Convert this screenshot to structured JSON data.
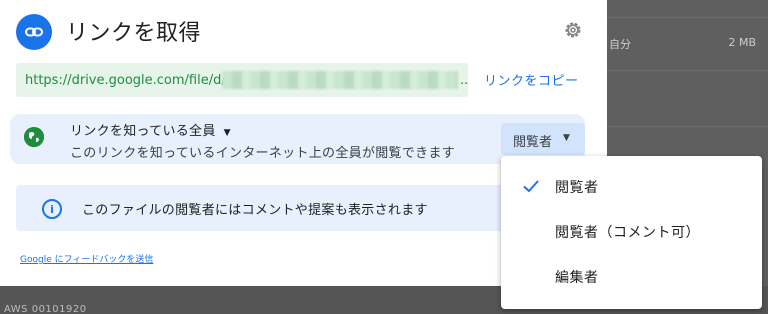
{
  "background": {
    "owner_text": "自分",
    "size_text": "2 MB",
    "bottom_text": "AWS 00101920"
  },
  "dialog": {
    "title": "リンクを取得",
    "link_url": "https://drive.google.com/file/d/",
    "link_ellipsis": "...",
    "copy_link_label": "リンクをコピー",
    "access": {
      "title": "リンクを知っている全員",
      "description": "このリンクを知っているインターネット上の全員が閲覧できます",
      "role_label": "閲覧者"
    },
    "info_text": "このファイルの閲覧者にはコメントや提案も表示されます",
    "feedback_label": "Google にフィードバックを送信"
  },
  "role_menu": {
    "items": [
      {
        "label": "閲覧者",
        "selected": true
      },
      {
        "label": "閲覧者（コメント可）",
        "selected": false
      },
      {
        "label": "編集者",
        "selected": false
      }
    ]
  },
  "colors": {
    "accent": "#1a73e8",
    "link_green": "#1e8e3e",
    "access_bg": "#e8f0fe"
  },
  "icons": {
    "title": "link-icon",
    "settings": "gear-icon",
    "access": "globe-icon",
    "info": "info-icon",
    "check": "check-icon"
  }
}
